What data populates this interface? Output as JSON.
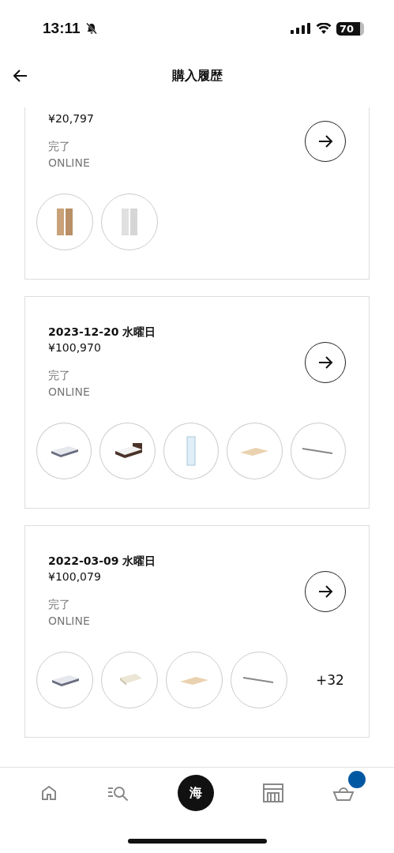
{
  "status_bar": {
    "time": "13:11",
    "battery": "70"
  },
  "header": {
    "title": "購入履歴"
  },
  "orders": [
    {
      "price": "¥20,797",
      "status": "完了",
      "channel": "ONLINE",
      "items": [
        {
          "kind": "curtain-wood"
        },
        {
          "kind": "curtain-white"
        }
      ]
    },
    {
      "date": "2023-12-20 水曜日",
      "price": "¥100,970",
      "status": "完了",
      "channel": "ONLINE",
      "items": [
        {
          "kind": "mattress"
        },
        {
          "kind": "bed"
        },
        {
          "kind": "mirror"
        },
        {
          "kind": "slats"
        },
        {
          "kind": "rail"
        }
      ]
    },
    {
      "date": "2022-03-09 水曜日",
      "price": "¥100,079",
      "status": "完了",
      "channel": "ONLINE",
      "items": [
        {
          "kind": "mattress"
        },
        {
          "kind": "topper"
        },
        {
          "kind": "slats"
        },
        {
          "kind": "rail"
        }
      ],
      "more": "+32"
    }
  ],
  "bottom_nav": {
    "profile_initial": "海"
  }
}
